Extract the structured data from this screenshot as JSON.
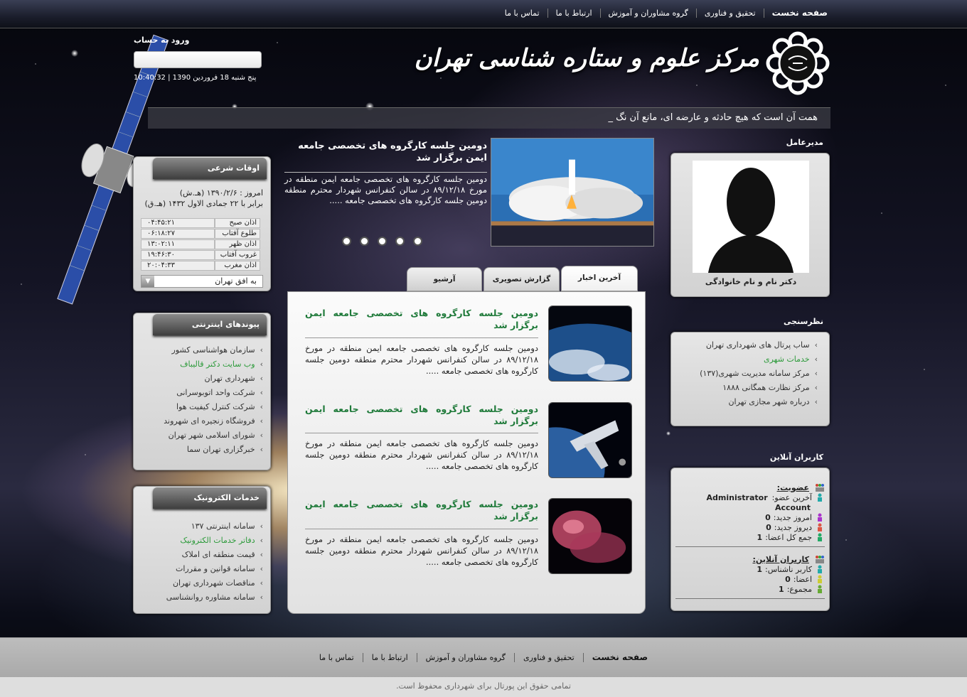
{
  "nav": {
    "items": [
      "صفحه نخست",
      "تحقیق و فناوری",
      "گروه مشاوران و آموزش",
      "ارتباط با ما",
      "تماس با ما"
    ]
  },
  "site": {
    "title": "مرکز علوم و ستاره شناسی تهران"
  },
  "login": {
    "title": "ورود به حساب",
    "placeholder": "",
    "clock": "10:40:32 | پنج شنبه 18 فروردین 1390"
  },
  "marquee": "همت آن است که هیچ حادثه و عارضه ای، مانع آن نگ _",
  "prayer": {
    "title": "اوقات شرعی",
    "today": "امروز : ۱۳۹۰/۲/۶ (هـ.ش)",
    "hijri": "برابر با ۲۲ جمادی الاول ۱۴۳۲ (هـ.ق)",
    "rows": [
      {
        "label": "اذان صبح",
        "time": "۰۴:۴۵:۲۱"
      },
      {
        "label": "طلوع آفتاب",
        "time": "۰۶:۱۸:۲۷"
      },
      {
        "label": "اذان ظهر",
        "time": "۱۳:۰۲:۱۱"
      },
      {
        "label": "غروب آفتاب",
        "time": "۱۹:۴۶:۳۰"
      },
      {
        "label": "اذان مغرب",
        "time": "۲۰:۰۴:۳۳"
      }
    ],
    "city": "به افق تهران"
  },
  "links_panel": {
    "title": "پیوندهای اینترنتی",
    "items": [
      "سازمان هواشناسی کشور",
      "وب سایت دکتر قالیباف",
      "شهرداری تهران",
      "شرکت واحد اتوبوسرانی",
      "شرکت کنترل کیفیت هوا",
      "فروشگاه زنجیره ای شهروند",
      "شورای اسلامی شهر تهران",
      "خبرگزاری تهران سما"
    ],
    "highlight": 1
  },
  "eservices": {
    "title": "خدمات الکترونیک",
    "items": [
      "سامانه اینترنتی ۱۳۷",
      "دفاتر خدمات الکترونیک",
      "قیمت منطقه ای املاک",
      "سامانه قوانین و مقررات",
      "مناقصات شهرداری تهران",
      "سامانه مشاوره روانشناسی"
    ],
    "highlight": 1
  },
  "slider": {
    "title": "دومین جلسه کارگروه های تخصصی جامعه ایمن برگزار شد",
    "text": "دومین جلسه کارگروه های تخصصی جامعه ایمن منطقه در مورخ ۸۹/۱۲/۱۸ در سالن کنفرانس شهردار محترم منطقه دومین جلسه کارگروه های تخصصی جامعه .....",
    "dots": 5
  },
  "tabs": [
    "آخرین اخبار",
    "گزارش تصویری",
    "آرشیو"
  ],
  "news": [
    {
      "title": "دومین جلسه کارگروه های تخصصی جامعه ایمن برگزار شد",
      "text": "دومین جلسه کارگروه های تخصصی جامعه ایمن منطقه در مورخ ۸۹/۱۲/۱۸ در سالن کنفرانس شهردار محترم منطقه دومین جلسه کارگروه های تخصصی جامعه .....",
      "image": "earth-image"
    },
    {
      "title": "دومین جلسه کارگروه های تخصصی جامعه ایمن برگزار شد",
      "text": "دومین جلسه کارگروه های تخصصی جامعه ایمن منطقه در مورخ ۸۹/۱۲/۱۸ در سالن کنفرانس شهردار محترم منطقه دومین جلسه کارگروه های تخصصی جامعه .....",
      "image": "spaceship-image"
    },
    {
      "title": "دومین جلسه کارگروه های تخصصی جامعه ایمن برگزار شد",
      "text": "دومین جلسه کارگروه های تخصصی جامعه ایمن منطقه در مورخ ۸۹/۱۲/۱۸ در سالن کنفرانس شهردار محترم منطقه دومین جلسه کارگروه های تخصصی جامعه .....",
      "image": "nebula-image"
    }
  ],
  "ceo": {
    "heading": "مدیرعامل",
    "name": "دکتر نام و نام خانوادگی"
  },
  "poll": {
    "heading": "نظرسنجی",
    "items": [
      "ساب پرتال های شهرداری تهران",
      "خدمات شهری",
      "مرکز سامانه مدیریت شهری(۱۳۷)",
      "مرکز نظارت همگانی ۱۸۸۸",
      "درباره شهر مجازی تهران"
    ],
    "highlight": 1
  },
  "online": {
    "heading": "کاربران آنلاین",
    "membership": {
      "title": "عضویت:",
      "last_label": "آخرین عضو:",
      "last_value": "Administrator",
      "last_value2": "Account",
      "today_label": "امروز جدید:",
      "today": "0",
      "yesterday_label": "دیروز جدید:",
      "yesterday": "0",
      "total_label": "جمع کل اعضا:",
      "total": "1"
    },
    "users": {
      "title": "کاربران آنلاین:",
      "guests_label": "کاربر ناشناس:",
      "guests": "1",
      "members_label": "اعضا:",
      "members": "0",
      "sum_label": "مجموع:",
      "sum": "1"
    }
  },
  "footer": {
    "copyright": "تمامی حقوق این پورتال برای شهرداری محفوظ است."
  },
  "colors": {
    "accent_green": "#1f7a3a",
    "link_green": "#2c9a3a"
  }
}
